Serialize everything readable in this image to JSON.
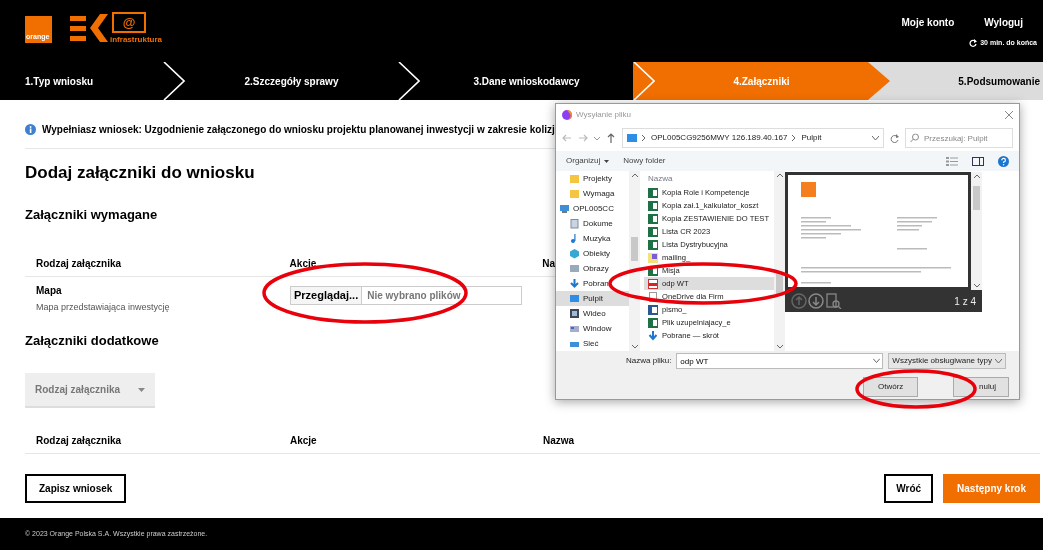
{
  "header": {
    "logo_text": "orange",
    "logo_symbol": "@",
    "brand_text": "infrastruktura",
    "account_link": "Moje konto",
    "logout_link": "Wyloguj",
    "session_timer": "30 min. do końca"
  },
  "steps": [
    {
      "label": "1.Typ wniosku",
      "selected": false,
      "completed": true
    },
    {
      "label": "2.Szczegóły sprawy",
      "selected": false,
      "completed": true
    },
    {
      "label": "3.Dane wnioskodawcy",
      "selected": false,
      "completed": true
    },
    {
      "label": "4.Załączniki",
      "selected": true,
      "completed": false
    },
    {
      "label": "5.Podsumowanie",
      "selected": false,
      "completed": false
    }
  ],
  "info_text": "Wypełniasz wniosek: Uzgodnienie załączonego do wniosku projektu planowanej inwestycji w zakresie kolizj",
  "page_title": "Dodaj załączniki do wniosku",
  "required_section": {
    "title": "Załączniki wymagane",
    "columns": [
      "Rodzaj załącznika",
      "Akcje",
      "Na"
    ],
    "rows": [
      {
        "name": "Mapa",
        "description": "Mapa przedstawiająca inwestycję",
        "browse_button": "Przeglądaj...",
        "file_status": "Nie wybrano plików"
      }
    ]
  },
  "additional_section": {
    "title": "Załączniki dodatkowe",
    "type_select": {
      "placeholder": "Rodzaj załącznika"
    },
    "columns": [
      "Rodzaj załącznika",
      "Akcje",
      "Nazwa"
    ]
  },
  "buttons": {
    "save": "Zapisz wniosek",
    "back": "Wróć",
    "next": "Następny krok"
  },
  "footer": "© 2023 Orange Polska S.A. Wszystkie prawa zastrzeżone.",
  "dialog": {
    "title": "Wysyłanie pliku",
    "path": [
      "OPL005CG9256MWY 126.189.40.167",
      "Pulpit"
    ],
    "search_placeholder": "Przeszukaj: Pulpit",
    "organize": "Organizuj",
    "new_folder": "Nowy folder",
    "nav": [
      {
        "label": "Projekty",
        "kind": "folder",
        "selected": false
      },
      {
        "label": "Wymaga",
        "kind": "folder",
        "selected": false
      },
      {
        "label": "OPL005CC",
        "kind": "pc",
        "selected": false,
        "children": [
          {
            "label": "Dokume",
            "kind": "documents",
            "selected": false
          },
          {
            "label": "Muzyka",
            "kind": "music",
            "selected": false
          },
          {
            "label": "Obiekty",
            "kind": "objects",
            "selected": false
          },
          {
            "label": "Obrazy",
            "kind": "pictures",
            "selected": false
          },
          {
            "label": "Pobran",
            "kind": "downloads",
            "selected": false
          },
          {
            "label": "Pulpit",
            "kind": "desktop",
            "selected": true
          },
          {
            "label": "Wideo",
            "kind": "video",
            "selected": false
          },
          {
            "label": "Window",
            "kind": "drive",
            "selected": false
          }
        ]
      },
      {
        "label": "Sieć",
        "kind": "network",
        "selected": false
      }
    ],
    "list_header": "Nazwa",
    "files": [
      {
        "name": "Kopia Role i Kompetencje",
        "kind": "excel",
        "selected": false
      },
      {
        "name": "Kopia zał.1_kalkulator_koszt",
        "kind": "excel",
        "selected": false
      },
      {
        "name": "Kopia ZESTAWIENIE DO TEST",
        "kind": "excel",
        "selected": false
      },
      {
        "name": "Lista CR  2023",
        "kind": "excel",
        "selected": false
      },
      {
        "name": "Lista Dystrybucyjna",
        "kind": "excel",
        "selected": false
      },
      {
        "name": "mailing_",
        "kind": "mail",
        "selected": false
      },
      {
        "name": "Misja",
        "kind": "excel",
        "selected": false
      },
      {
        "name": "odp WT",
        "kind": "pdf",
        "selected": true
      },
      {
        "name": "OneDrive dla Firm",
        "kind": "shortcut",
        "selected": false
      },
      {
        "name": "pismo_",
        "kind": "word",
        "selected": false
      },
      {
        "name": "Plik uzupelniajacy_e",
        "kind": "excel",
        "selected": false
      },
      {
        "name": "Pobrane — skrót",
        "kind": "link",
        "selected": false
      }
    ],
    "preview_page": "1 z 4",
    "filename_label": "Nazwa pliku:",
    "filename_value": "odp WT",
    "filetype": "Wszystkie obsługiwane typy",
    "open_button": "Otwórz",
    "cancel_button": "nuluj"
  }
}
